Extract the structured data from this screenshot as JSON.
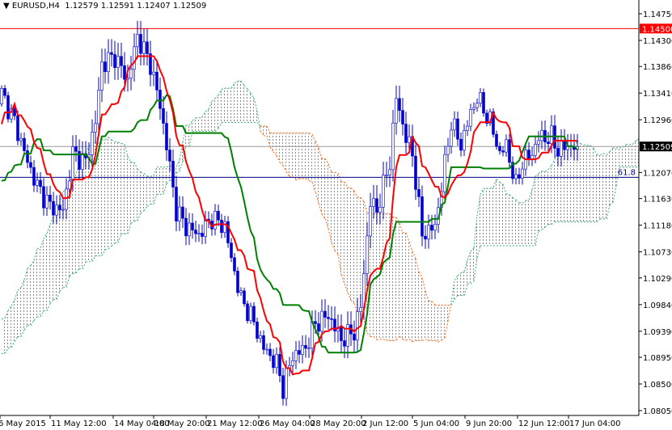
{
  "header": {
    "symbol": "EURUSD,H4",
    "ohlc": "1.12579 1.12591 1.12407 1.12509",
    "menu_icon": "triangle-down-icon"
  },
  "chart_data": {
    "type": "candlestick",
    "title": "EURUSD,H4",
    "indicator": "Ichimoku Kinko Hyo (9, 26, 52)",
    "ylim": [
      1.0805,
      1.1475
    ],
    "y_ticks": [
      "1.14750",
      "1.14300",
      "1.13860",
      "1.13410",
      "1.12960",
      "1.12070",
      "1.11630",
      "1.11180",
      "1.10730",
      "1.10290",
      "1.09840",
      "1.09390",
      "1.08950",
      "1.08500",
      "1.08050"
    ],
    "x_ticks": [
      "6 May 2015",
      "11 May 12:00",
      "14 May 04:00",
      "18 May 20:00",
      "21 May 12:00",
      "26 May 04:00",
      "28 May 20:00",
      "2 Jun 12:00",
      "5 Jun 04:00",
      "9 Jun 20:00",
      "12 Jun 12:00",
      "17 Jun 04:00"
    ],
    "price_path_anchors": [
      [
        -80,
        1.09
      ],
      [
        -60,
        1.075
      ],
      [
        -45,
        1.082
      ],
      [
        -30,
        1.1
      ],
      [
        -15,
        1.118
      ],
      [
        -5,
        1.13
      ],
      [
        0,
        1.1341
      ],
      [
        4,
        1.1293
      ],
      [
        8,
        1.1225
      ],
      [
        11,
        1.1184
      ],
      [
        15,
        1.115
      ],
      [
        19,
        1.1143
      ],
      [
        22,
        1.1239
      ],
      [
        26,
        1.1225
      ],
      [
        29,
        1.1293
      ],
      [
        31,
        1.139
      ],
      [
        35,
        1.1403
      ],
      [
        39,
        1.1362
      ],
      [
        42,
        1.1437
      ],
      [
        46,
        1.139
      ],
      [
        49,
        1.132
      ],
      [
        51,
        1.1253
      ],
      [
        54,
        1.1143
      ],
      [
        57,
        1.1116
      ],
      [
        61,
        1.1102
      ],
      [
        65,
        1.113
      ],
      [
        69,
        1.1116
      ],
      [
        71,
        1.1062
      ],
      [
        74,
        1.0993
      ],
      [
        77,
        1.0966
      ],
      [
        81,
        1.0911
      ],
      [
        85,
        1.0884
      ],
      [
        87,
        1.0843
      ],
      [
        90,
        1.0898
      ],
      [
        94,
        1.0911
      ],
      [
        97,
        1.0952
      ],
      [
        101,
        1.0966
      ],
      [
        105,
        1.0925
      ],
      [
        109,
        1.0939
      ],
      [
        111,
        1.098
      ],
      [
        114,
        1.1157
      ],
      [
        116,
        1.1143
      ],
      [
        120,
        1.1225
      ],
      [
        122,
        1.1334
      ],
      [
        125,
        1.1266
      ],
      [
        127,
        1.1239
      ],
      [
        130,
        1.1102
      ],
      [
        134,
        1.1116
      ],
      [
        136,
        1.1184
      ],
      [
        139,
        1.1293
      ],
      [
        142,
        1.1253
      ],
      [
        145,
        1.1307
      ],
      [
        147,
        1.1334
      ],
      [
        151,
        1.1293
      ],
      [
        154,
        1.1239
      ],
      [
        156,
        1.1253
      ],
      [
        159,
        1.1184
      ],
      [
        161,
        1.1225
      ],
      [
        164,
        1.1239
      ],
      [
        166,
        1.1266
      ],
      [
        170,
        1.1266
      ],
      [
        172,
        1.1245
      ],
      [
        175,
        1.1252
      ],
      [
        178,
        1.12509
      ]
    ],
    "current_price": "1.12509",
    "levels": [
      {
        "name": "resistance",
        "value": "1.14500",
        "color": "#ff0000"
      },
      {
        "name": "fib-61.8",
        "label": "61.8",
        "value": 1.1207,
        "color": "#000080"
      }
    ],
    "colors": {
      "tenkan": "#ff0000",
      "kijun": "#008000",
      "cloud_up": "#3cb371",
      "cloud_down": "#ff6a1a",
      "candle": "#0000cc"
    }
  }
}
